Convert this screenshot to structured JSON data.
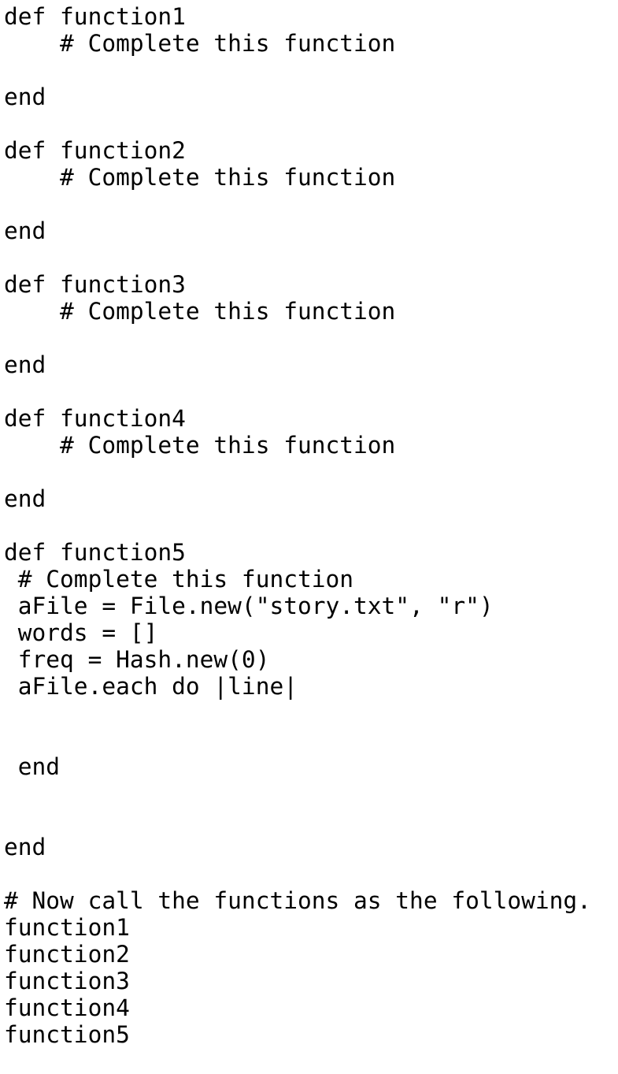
{
  "document": {
    "kind": "source-code-listing",
    "language": "ruby",
    "background_color": "#ffffff",
    "text_color": "#000000",
    "lines": [
      {
        "id": "l01",
        "text": "def function1",
        "blank": false
      },
      {
        "id": "l02",
        "text": "    # Complete this function",
        "blank": false
      },
      {
        "id": "l03",
        "text": "",
        "blank": true
      },
      {
        "id": "l04",
        "text": "end",
        "blank": false
      },
      {
        "id": "l05",
        "text": "",
        "blank": true
      },
      {
        "id": "l06",
        "text": "def function2",
        "blank": false
      },
      {
        "id": "l07",
        "text": "    # Complete this function",
        "blank": false
      },
      {
        "id": "l08",
        "text": "",
        "blank": true
      },
      {
        "id": "l09",
        "text": "end",
        "blank": false
      },
      {
        "id": "l10",
        "text": "",
        "blank": true
      },
      {
        "id": "l11",
        "text": "def function3",
        "blank": false
      },
      {
        "id": "l12",
        "text": "    # Complete this function",
        "blank": false
      },
      {
        "id": "l13",
        "text": "",
        "blank": true
      },
      {
        "id": "l14",
        "text": "end",
        "blank": false
      },
      {
        "id": "l15",
        "text": "",
        "blank": true
      },
      {
        "id": "l16",
        "text": "def function4",
        "blank": false
      },
      {
        "id": "l17",
        "text": "    # Complete this function",
        "blank": false
      },
      {
        "id": "l18",
        "text": "",
        "blank": true
      },
      {
        "id": "l19",
        "text": "end",
        "blank": false
      },
      {
        "id": "l20",
        "text": "",
        "blank": true
      },
      {
        "id": "l21",
        "text": "def function5",
        "blank": false
      },
      {
        "id": "l22",
        "text": " # Complete this function",
        "blank": false
      },
      {
        "id": "l23",
        "text": " aFile = File.new(\"story.txt\", \"r\")",
        "blank": false
      },
      {
        "id": "l24",
        "text": " words = []",
        "blank": false
      },
      {
        "id": "l25",
        "text": " freq = Hash.new(0)",
        "blank": false
      },
      {
        "id": "l26",
        "text": " aFile.each do |line|",
        "blank": false
      },
      {
        "id": "l27",
        "text": "",
        "blank": true
      },
      {
        "id": "l28",
        "text": "",
        "blank": true
      },
      {
        "id": "l29",
        "text": " end",
        "blank": false
      },
      {
        "id": "l30",
        "text": "",
        "blank": true
      },
      {
        "id": "l31",
        "text": "",
        "blank": true
      },
      {
        "id": "l32",
        "text": "end",
        "blank": false
      },
      {
        "id": "l33",
        "text": "",
        "blank": true
      },
      {
        "id": "l34",
        "text": "# Now call the functions as the following.",
        "blank": false
      },
      {
        "id": "l35",
        "text": "function1",
        "blank": false
      },
      {
        "id": "l36",
        "text": "function2",
        "blank": false
      },
      {
        "id": "l37",
        "text": "function3",
        "blank": false
      },
      {
        "id": "l38",
        "text": "function4",
        "blank": false
      },
      {
        "id": "l39",
        "text": "function5",
        "blank": false
      }
    ]
  }
}
